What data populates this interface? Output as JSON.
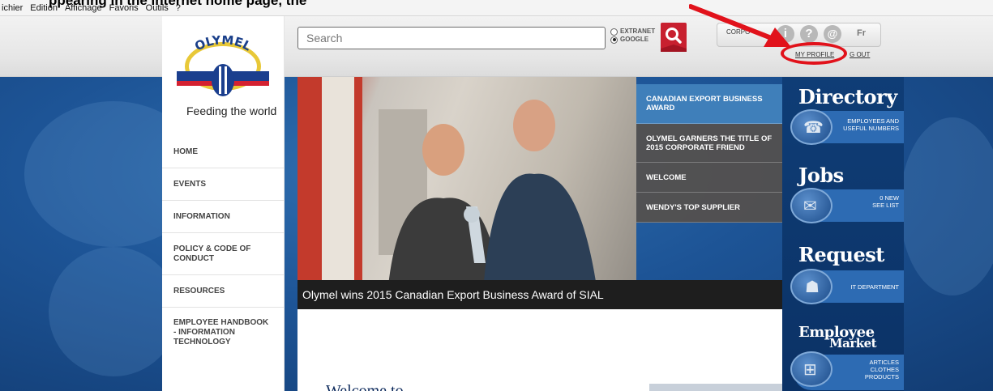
{
  "browser": {
    "menu": [
      "ichier",
      "Edition",
      "Affichage",
      "Favoris",
      "Outils",
      "?"
    ],
    "cut_title": "ppearing in the internet home page, the"
  },
  "brand": {
    "logo_text": "OLYMEL",
    "tagline": "Feeding the world"
  },
  "search": {
    "placeholder": "Search",
    "options": [
      {
        "label": "EXTRANET",
        "selected": false
      },
      {
        "label": "GOOGLE",
        "selected": true
      }
    ]
  },
  "tools": {
    "corporate_label": "CORPO",
    "icons": [
      "info-icon",
      "help-icon",
      "email-icon"
    ],
    "language": "Fr",
    "links": [
      "MY PROFILE",
      "LOG OUT"
    ],
    "log_out_visible": "G OUT"
  },
  "nav": {
    "items": [
      "HOME",
      "EVENTS",
      "INFORMATION",
      "POLICY & CODE OF CONDUCT",
      "RESOURCES",
      "EMPLOYEE HANDBOOK - INFORMATION TECHNOLOGY"
    ]
  },
  "hero": {
    "caption": "Olymel wins 2015 Canadian Export Business Award of SIAL"
  },
  "slides": [
    {
      "label": "CANADIAN EXPORT BUSINESS AWARD",
      "active": true
    },
    {
      "label": "OLYMEL GARNERS THE TITLE OF 2015 CORPORATE FRIEND",
      "active": false
    },
    {
      "label": "WELCOME",
      "active": false
    },
    {
      "label": "WENDY'S TOP SUPPLIER",
      "active": false
    }
  ],
  "content": {
    "heading_partial": "Welcome to ..."
  },
  "widgets": [
    {
      "title": "Directory",
      "sub": "EMPLOYEES AND USEFUL NUMBERS",
      "icon": "phone-icon"
    },
    {
      "title": "Jobs",
      "sub": "0 NEW\nSEE LIST",
      "icon": "folder-icon"
    },
    {
      "title": "Request",
      "sub": "IT DEPARTMENT",
      "icon": "person-icon"
    },
    {
      "title": "Employee",
      "title2": "Market",
      "sub": "ARTICLES\nCLOTHES\nPRODUCTS",
      "icon": "cart-icon"
    }
  ],
  "colors": {
    "accent_red": "#c8202f",
    "annotation_red": "#e1121b",
    "corporate_blue": "#1d5496",
    "slide_active": "#3f7fba"
  }
}
